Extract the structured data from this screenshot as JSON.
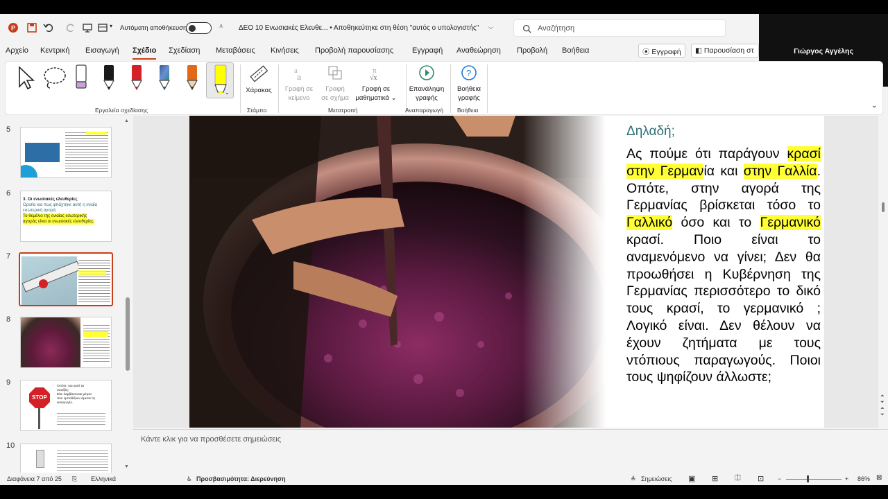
{
  "titlebar": {
    "autosave_label": "Αυτόματη αποθήκευση",
    "doc_title": "ΔΕΟ 10 Ενωσιακές Ελευθε...  •  Αποθηκεύτηκε στη θέση \"αυτός ο υπολογιστής\"",
    "search_placeholder": "Αναζήτηση",
    "user_name": "Γιώργος Αγγέλης"
  },
  "menu": {
    "items": [
      "Αρχείο",
      "Κεντρική",
      "Εισαγωγή",
      "Σχέδιο",
      "Σχεδίαση",
      "Μεταβάσεις",
      "Κινήσεις",
      "Προβολή παρουσίασης",
      "Εγγραφή",
      "Αναθεώρηση",
      "Προβολή",
      "Βοήθεια"
    ],
    "active": "Σχέδιο",
    "record_button": "Εγγραφή",
    "present_button": "Παρουσίαση στ"
  },
  "ribbon": {
    "groups": {
      "drawing_tools": "Εργαλεία σχεδίασης",
      "stencils": "Στάμπο",
      "convert": "Μετατροπή",
      "replay": "Αναπαραγωγή",
      "help": "Βοήθεια"
    },
    "ruler": "Χάρακας",
    "ink_to_text": [
      "Γραφή σε",
      "κείμενο"
    ],
    "ink_to_shape": [
      "Γραφή",
      "σε σχήμα"
    ],
    "ink_to_math": [
      "Γραφή σε",
      "μαθηματικά"
    ],
    "ink_replay": [
      "Επανάληψη",
      "γραφής"
    ],
    "ink_help": [
      "Βοήθεια",
      "γραφής"
    ],
    "pen_colors": [
      "#1a1a1a",
      "#d42027",
      "#2f5e8f",
      "#e06a17"
    ],
    "highlighter_color": "#ffff00"
  },
  "slides": {
    "numbers": [
      "5",
      "6",
      "7",
      "8",
      "9",
      "10"
    ],
    "thumb6_title": "3. Οι ενωσιακές ελευθερίες",
    "thumb6_line1": "Ορισία και πως φτιάχτηκε αυτή η ενιαία",
    "thumb6_line2": "εσωτερική αγορά;",
    "thumb6_line3": "Το θεμέλιο της ενιαίας εσωτερικής",
    "thumb6_line4": "αγοράς είναι οι ενωσιακές ελευθερίες.",
    "thumb9_stop": "STOP",
    "thumb9_text1": "Οπότε, και γιατί τα",
    "thumb9_text2": "συνέβη;",
    "thumb9_text3": "Είτε λαμβάνονται μέτρα",
    "thumb9_text4": "που εμποδίζουν άμεσα τις",
    "thumb9_text5": "εισαγωγές."
  },
  "slide": {
    "title": "Δηλαδή;",
    "body": [
      {
        "t": "Ας πούμε ότι παράγουν ",
        "h": false
      },
      {
        "t": "κρασί στην Γερμαν",
        "h": true
      },
      {
        "t": "ία και ",
        "h": false
      },
      {
        "t": "στην Γαλλία",
        "h": true
      },
      {
        "t": ". Οπότε, στην αγορά της Γερμανίας βρίσκεται τόσο το ",
        "h": false
      },
      {
        "t": "Γαλλικό",
        "h": true
      },
      {
        "t": " όσο και το ",
        "h": false
      },
      {
        "t": "Γερμανικό",
        "h": true
      },
      {
        "t": " κρασί. Ποιο είναι το αναμενόμενο να γίνει; Δεν θα προωθήσει η Κυβέρνηση της Γερμανίας περισσότερο το δικό τους κρασί, το γερμανικό ; Λογικό είναι. Δεν θέλουν να έχουν ζητήματα με τους ντόπιους παραγωγούς. Ποιοι τους ψηφίζουν άλλωστε;",
        "h": false
      }
    ]
  },
  "notes_placeholder": "Κάντε κλικ για να προσθέσετε σημειώσεις",
  "status": {
    "slide_counter": "Διαφάνεια 7 από 25",
    "language": "Ελληνικά",
    "accessibility": "Προσβασιμότητα: Διερεύνηση",
    "notes": "Σημειώσεις",
    "zoom": "86%"
  }
}
